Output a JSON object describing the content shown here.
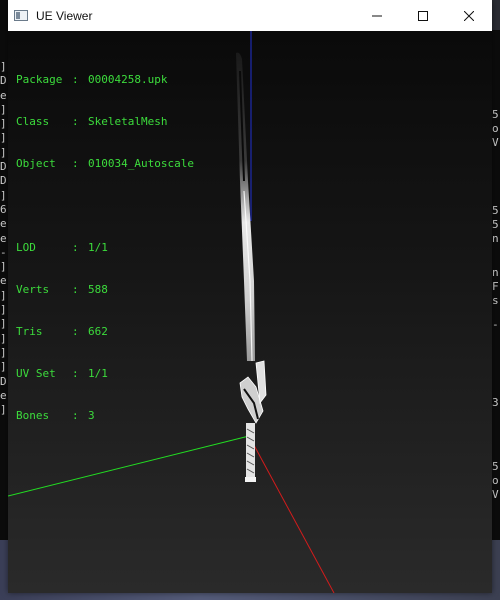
{
  "window": {
    "title": "UE Viewer",
    "controls": {
      "minimize": "—",
      "maximize": "☐",
      "close": "✕"
    }
  },
  "info": {
    "package": {
      "label": "Package",
      "sep": ":",
      "value": "00004258.upk"
    },
    "class": {
      "label": "Class",
      "sep": ":",
      "value": "SkeletalMesh"
    },
    "object": {
      "label": "Object",
      "sep": ":",
      "value": "010034_Autoscale"
    },
    "lod": {
      "label": "LOD",
      "sep": ":",
      "value": "1/1"
    },
    "verts": {
      "label": "Verts",
      "sep": ":",
      "value": "588"
    },
    "tris": {
      "label": "Tris",
      "sep": ":",
      "value": "662"
    },
    "uvset": {
      "label": "UV Set",
      "sep": ":",
      "value": "1/1"
    },
    "bones": {
      "label": "Bones",
      "sep": ":",
      "value": "3"
    }
  },
  "background": {
    "left_console": [
      "]",
      "D",
      "e",
      "]",
      "]",
      "]",
      "]",
      "D",
      "D",
      "]",
      "6",
      "e",
      "e",
      "-",
      "]",
      "e",
      "]",
      "]",
      "]",
      "]",
      "]",
      "]",
      "D",
      "e",
      "]"
    ],
    "right_console": [
      "5",
      "o",
      "V",
      "5",
      "5",
      "n",
      "n",
      "F",
      "s",
      "-",
      "3",
      "5",
      "o",
      "V"
    ]
  },
  "colors": {
    "info_text": "#3cdc3c",
    "axis_x": "#d21c1c",
    "axis_y": "#22dd22",
    "axis_z": "#2030d0"
  }
}
